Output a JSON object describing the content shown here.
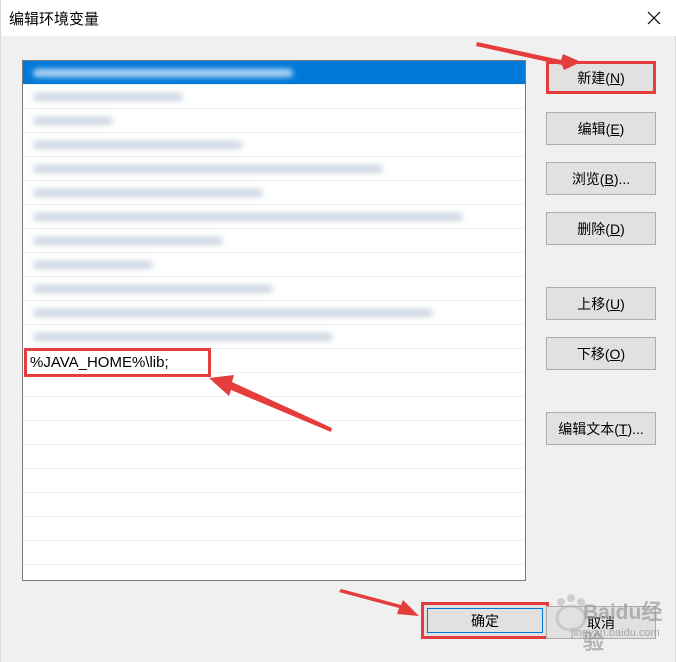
{
  "window": {
    "title": "编辑环境变量"
  },
  "list": {
    "editing_value": "%JAVA_HOME%\\lib;"
  },
  "buttons": {
    "new_label": "新建(",
    "new_key": "N",
    "edit_label": "编辑(",
    "edit_key": "E",
    "browse_label": "浏览(",
    "browse_key": "B",
    "browse_suffix": ")...",
    "delete_label": "删除(",
    "delete_key": "D",
    "up_label": "上移(",
    "up_key": "U",
    "down_label": "下移(",
    "down_key": "O",
    "edit_text_label": "编辑文本(",
    "edit_text_key": "T",
    "edit_text_suffix": ")...",
    "close_paren": ")",
    "ok_label": "确定",
    "cancel_label": "取消"
  },
  "watermark": {
    "brand": "Baidu经验",
    "url": "jingyan.baidu.com"
  },
  "colors": {
    "highlight": "#e53c3c",
    "selection": "#0078d7"
  }
}
